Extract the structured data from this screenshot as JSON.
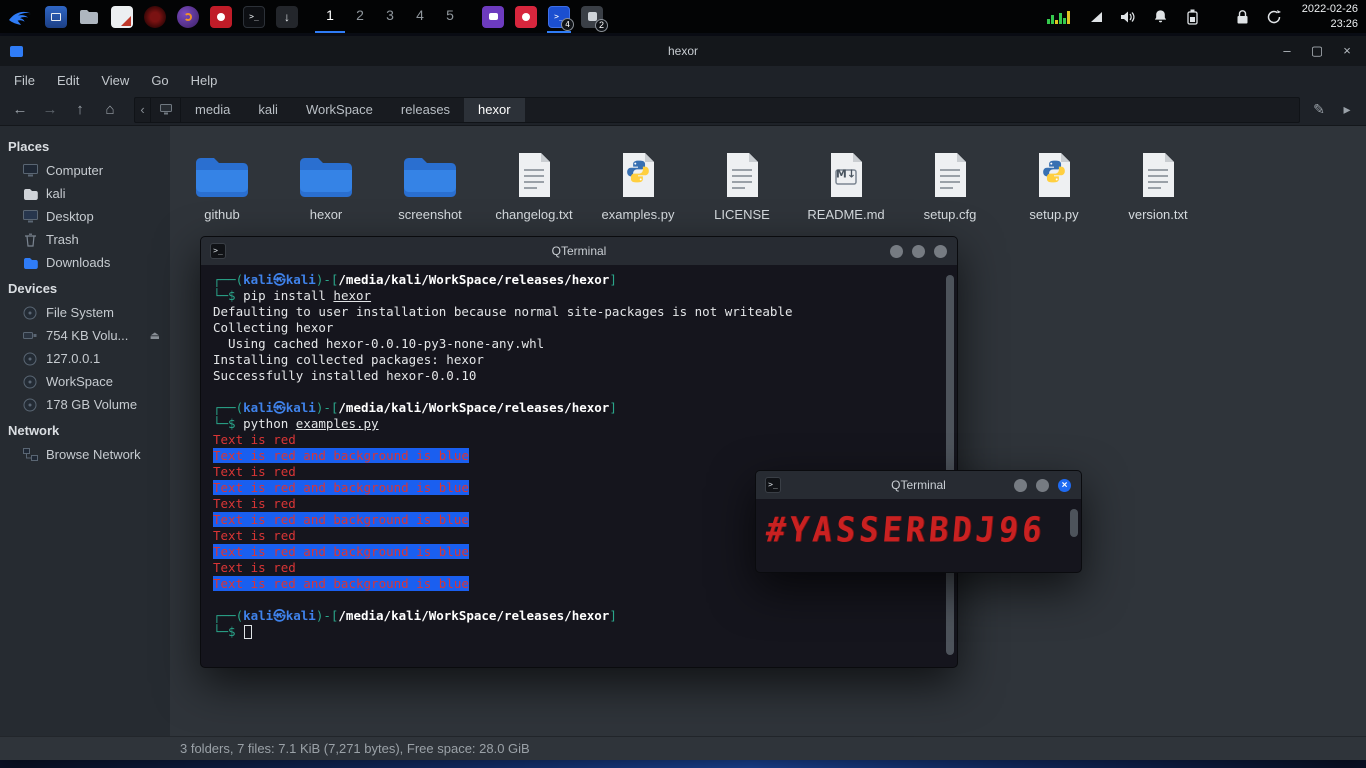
{
  "colors": {
    "accent_blue": "#2f7cf6",
    "terminal_red": "#d93535",
    "terminal_blue_bg": "#1a5ff0",
    "prompt_green": "#2aa58a",
    "prompt_user_blue": "#3f82ea",
    "folder_blue": "#2e7bde"
  },
  "icons": {
    "minimize": "–",
    "maximize": "▢",
    "close": "×",
    "back": "←",
    "forward": "→",
    "up": "↑",
    "home": "⌂",
    "crumb_prev": "‹",
    "edit_path": "✎",
    "go_next": "▸",
    "eject": "⏏",
    "terminal_prompt": ">_",
    "down_arrow": "↓",
    "md_glyph": "M↓"
  },
  "panel": {
    "workspaces": [
      "1",
      "2",
      "3",
      "4",
      "5"
    ],
    "badges": {
      "terminal": "4",
      "other": "2"
    },
    "clock": {
      "date": "2022-02-26",
      "time": "23:26"
    }
  },
  "fm": {
    "title": "hexor",
    "menus": {
      "file": "File",
      "edit": "Edit",
      "view": "View",
      "go": "Go",
      "help": "Help"
    },
    "crumbs": [
      "media",
      "kali",
      "WorkSpace",
      "releases",
      "hexor"
    ],
    "sidebar": {
      "places_header": "Places",
      "devices_header": "Devices",
      "network_header": "Network",
      "places": [
        "Computer",
        "kali",
        "Desktop",
        "Trash",
        "Downloads"
      ],
      "devices": [
        "File System",
        "754 KB Volu...",
        "127.0.0.1",
        "WorkSpace",
        "178 GB Volume"
      ],
      "network": [
        "Browse Network"
      ]
    },
    "files": [
      "github",
      "hexor",
      "screenshot",
      "changelog.txt",
      "examples.py",
      "LICENSE",
      "README.md",
      "setup.cfg",
      "setup.py",
      "version.txt"
    ],
    "status": "3 folders, 7 files: 7.1 KiB (7,271 bytes), Free space: 28.0 GiB"
  },
  "t1": {
    "title": "QTerminal",
    "p_open": "┌──(",
    "user": "kali㉿kali",
    "p_mid": ")-[",
    "path": "/media/kali/WorkSpace/releases/hexor",
    "p_close": "]",
    "p2": "└─$ ",
    "cmd1": "pip install ",
    "cmd1_arg": "hexor",
    "out1": "Defaulting to user installation because normal site-packages is not writeable",
    "out2": "Collecting hexor",
    "out3": "  Using cached hexor-0.0.10-py3-none-any.whl",
    "out4": "Installing collected packages: hexor",
    "out5": "Successfully installed hexor-0.0.10",
    "cmd2": "python ",
    "cmd2_arg": "examples.py",
    "red_line": "Text is red",
    "blue_line": "Text is red and background is blue"
  },
  "t2": {
    "title": "QTerminal",
    "banner": "#YASSERBDJ96"
  }
}
